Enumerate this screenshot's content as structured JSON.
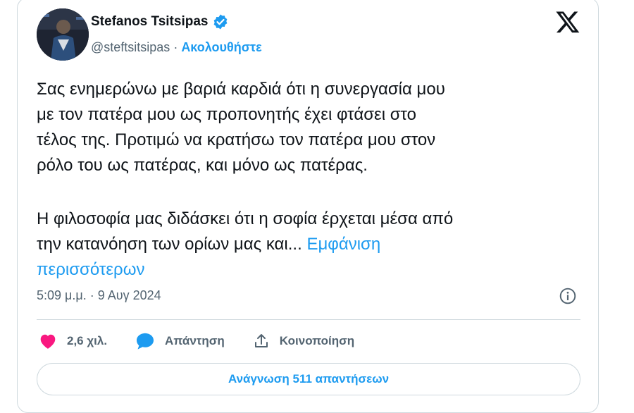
{
  "tweet": {
    "author_name": "Stefanos Tsitsipas",
    "handle": "@steftsitsipas",
    "separator": " · ",
    "follow_label": "Ακολουθήστε",
    "body_lines_p1": [
      "Σας ενημερώνω με βαριά καρδιά ότι η συνεργασία μου",
      "με τον πατέρα μου ως προπονητής έχει φτάσει στο",
      "τέλος της. Προτιμώ να κρατήσω τον πατέρα μου στον",
      "ρόλο του ως πατέρας, και μόνο ως πατέρας."
    ],
    "body_line_p2_1": "Η φιλοσοφία μας διδάσκει ότι η σοφία έρχεται μέσα από",
    "body_line_p2_2": "την κατανόηση των ορίων μας και... ",
    "show_more_part1": "Εμφάνιση",
    "show_more_part2": "περισσότερων",
    "timestamp": "5:09 μ.μ. · 9 Αυγ 2024",
    "likes_label": "2,6 χιλ.",
    "reply_label": "Απάντηση",
    "share_label": "Κοινοποίηση",
    "read_replies_label": "Ανάγνωση 511 απαντήσεων"
  },
  "colors": {
    "accent": "#1d9bf0",
    "like": "#f91880",
    "text": "#0f1419",
    "muted": "#536471",
    "border": "#cfd9de"
  },
  "icons": [
    "verified-badge-icon",
    "x-logo-icon",
    "info-icon",
    "heart-icon",
    "reply-bubble-icon",
    "share-icon"
  ]
}
